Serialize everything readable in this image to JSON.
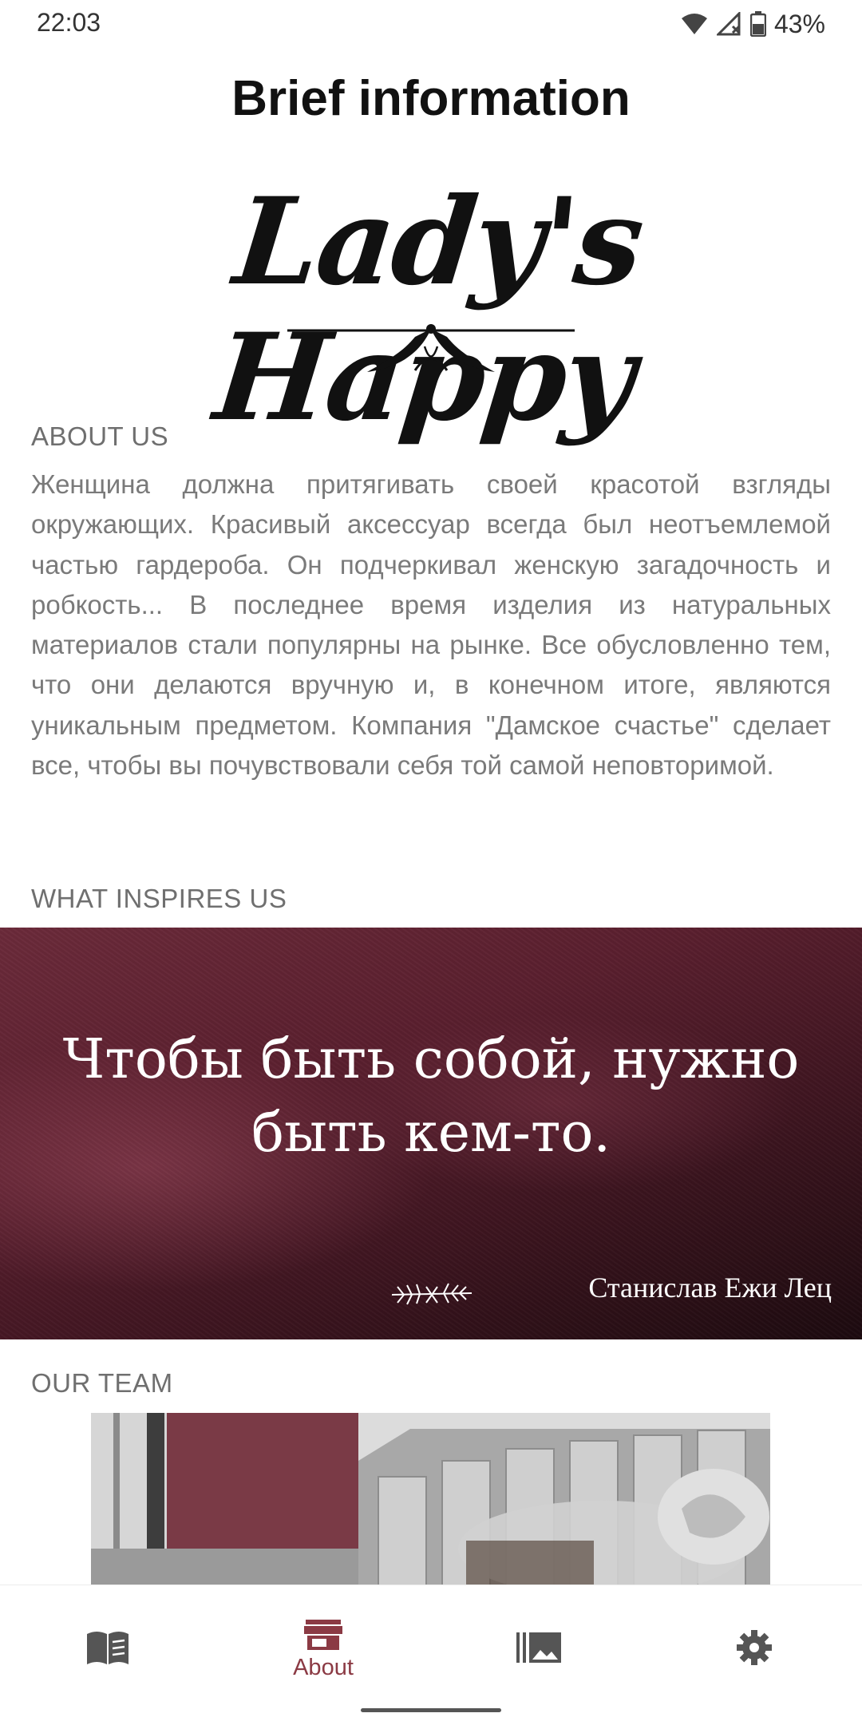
{
  "status_bar": {
    "time": "22:03",
    "battery": "43%",
    "icons": [
      "wifi-icon",
      "cell-signal-icon",
      "battery-icon"
    ]
  },
  "header": {
    "title": "Brief information"
  },
  "logo": {
    "text": "Lady's Happy"
  },
  "about": {
    "heading": "ABOUT US",
    "body": "Женщина должна притягивать своей красотой взгляды окружающих. Красивый аксессуар всегда был неотъемлемой частью гардероба. Он подчеркивал женскую загадочность и робкость... В последнее время изделия из натуральных материалов стали популярны на рынке. Все обусловленно тем, что они делаются вручную и, в конечном итоге, являются уникальным предметом. Компания \"Дамское счастье\" сделает все, чтобы вы почувствовали себя той самой неповторимой."
  },
  "inspires": {
    "heading": "WHAT INSPIRES US",
    "quote": "Чтобы быть собой, нужно быть кем-то.",
    "author": "Станислав Ежи Лец"
  },
  "team": {
    "heading": "OUR TEAM"
  },
  "bottom_nav": {
    "items": [
      {
        "icon": "book-icon",
        "label": ""
      },
      {
        "icon": "storefront-icon",
        "label": "About",
        "active": true
      },
      {
        "icon": "gallery-icon",
        "label": ""
      },
      {
        "icon": "gear-icon",
        "label": ""
      }
    ]
  },
  "colors": {
    "accent": "#8b3a44",
    "banner": "#5a1f2e",
    "text_muted": "#7a7a7a"
  }
}
